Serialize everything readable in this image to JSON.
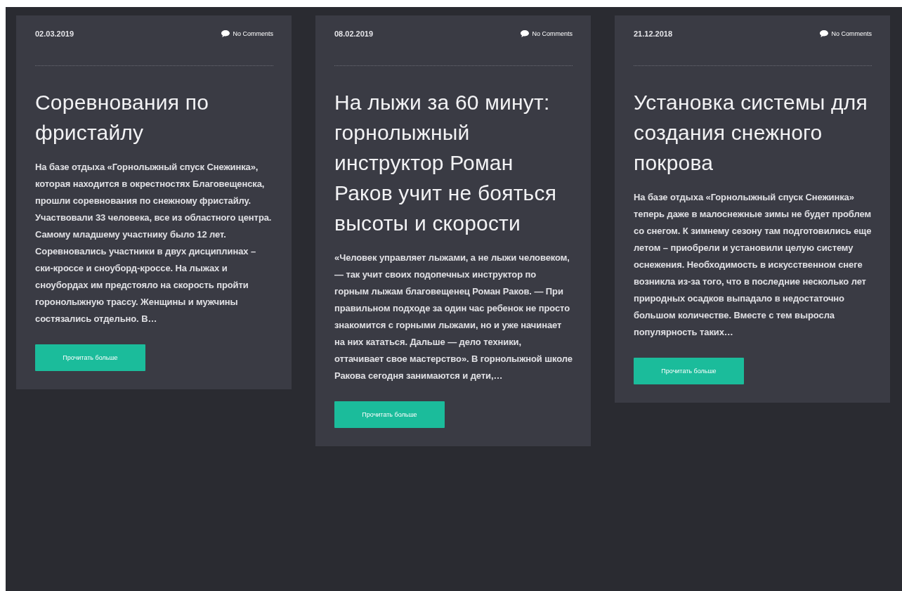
{
  "posts": [
    {
      "date": "02.03.2019",
      "comments": "No Comments",
      "title": "Соревнования по фристайлу",
      "excerpt": "На базе отдыха «Горнолыжный спуск Снежинка», которая находится в окрестностях Благовещенска, прошли соревнования по снежному фристайлу. Участвовали 33 человека, все из областного центра. Самому младшему участнику было 12 лет. Соревновались участники в двух дисциплинах – ски-кроссе и сноуборд-кроссе. На лыжах и сноубордах им предстояло на скорость пройти горонолыжную трассу. Женщины и мужчины состязались отдельно. В…",
      "button": "Прочитать больше"
    },
    {
      "date": "08.02.2019",
      "comments": "No Comments",
      "title": "На лыжи за 60 минут: горнолыжный инструктор Роман Раков учит не бояться высоты и скорости",
      "excerpt": "«Человек управляет лыжами, а не лыжи человеком, — так учит своих подопечных инструктор по горным лыжам благовещенец Роман Раков. — При правильном подходе за один час ребенок не просто знакомится с горными лыжами, но и уже начинает на них кататься. Дальше — дело техники, оттачивает свое мастерство». В горнолыжной школе Ракова сегодня занимаются и дети,…",
      "button": "Прочитать больше"
    },
    {
      "date": "21.12.2018",
      "comments": "No Comments",
      "title": "Установка системы для создания снежного покрова",
      "excerpt": "На базе отдыха «Горнолыжный спуск Снежинка» теперь даже в малоснежные зимы не будет проблем со снегом. К зимнему сезону там подготовились еще летом – приобрели и установили целую систему оснежения. Необходимость в искусственном снеге возникла из-за того, что в последние несколько лет природных осадков выпадало в недостаточно большом количестве. Вместе с тем выросла популярность таких…",
      "button": "Прочитать больше"
    }
  ]
}
